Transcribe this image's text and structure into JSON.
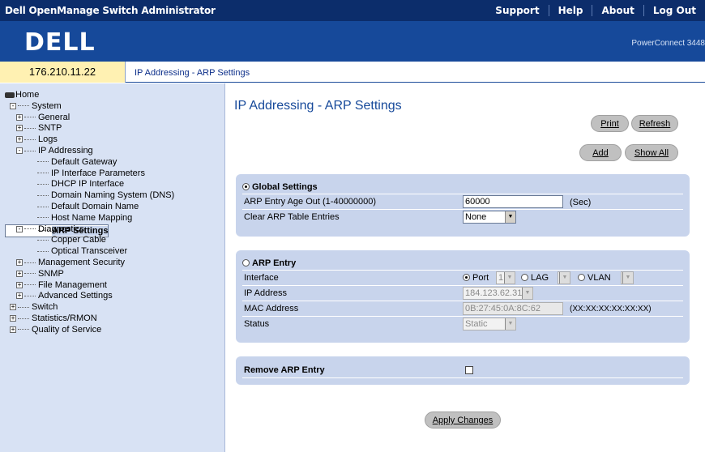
{
  "topbar": {
    "app_title": "Dell OpenManage Switch Administrator",
    "links": [
      "Support",
      "Help",
      "About",
      "Log Out"
    ]
  },
  "banner": {
    "logo": "DELL",
    "model": "PowerConnect 3448"
  },
  "addressbar": {
    "ip": "176.210.11.22",
    "breadcrumb": "IP Addressing - ARP Settings"
  },
  "sidebar": {
    "items": [
      {
        "label": "Home",
        "level": 0,
        "icon": "hdd-icon"
      },
      {
        "label": "System",
        "level": 1,
        "expander": "-"
      },
      {
        "label": "General",
        "level": 2,
        "expander": "+"
      },
      {
        "label": "SNTP",
        "level": 2,
        "expander": "+"
      },
      {
        "label": "Logs",
        "level": 2,
        "expander": "+"
      },
      {
        "label": "IP Addressing",
        "level": 2,
        "expander": "-"
      },
      {
        "label": "Default Gateway",
        "level": 3
      },
      {
        "label": "IP Interface Parameters",
        "level": 3
      },
      {
        "label": "DHCP IP Interface",
        "level": 3
      },
      {
        "label": "Domain Naming System (DNS)",
        "level": 3
      },
      {
        "label": "Default Domain Name",
        "level": 3
      },
      {
        "label": "Host Name Mapping",
        "level": 3
      },
      {
        "label": "ARP Settings",
        "level": 3,
        "selected": true
      },
      {
        "label": "Diagnostics",
        "level": 2,
        "expander": "-"
      },
      {
        "label": "Copper Cable",
        "level": 3
      },
      {
        "label": "Optical Transceiver",
        "level": 3
      },
      {
        "label": "Management Security",
        "level": 2,
        "expander": "+"
      },
      {
        "label": "SNMP",
        "level": 2,
        "expander": "+"
      },
      {
        "label": "File Management",
        "level": 2,
        "expander": "+"
      },
      {
        "label": "Advanced Settings",
        "level": 2,
        "expander": "+"
      },
      {
        "label": "Switch",
        "level": 1,
        "expander": "+"
      },
      {
        "label": "Statistics/RMON",
        "level": 1,
        "expander": "+"
      },
      {
        "label": "Quality of Service",
        "level": 1,
        "expander": "+"
      }
    ]
  },
  "main": {
    "title": "IP Addressing - ARP Settings",
    "buttons": {
      "print": "Print",
      "refresh": "Refresh",
      "add": "Add",
      "show_all": "Show All",
      "apply": "Apply Changes"
    },
    "global": {
      "header": "Global Settings",
      "age_label": "ARP Entry Age Out (1-40000000)",
      "age_value": "60000",
      "age_unit": "(Sec)",
      "clear_label": "Clear ARP Table Entries",
      "clear_value": "None"
    },
    "arp_entry": {
      "header": "ARP Entry",
      "interface_label": "Interface",
      "port_label": "Port",
      "port_value": "1",
      "lag_label": "LAG",
      "vlan_label": "VLAN",
      "ip_label": "IP Address",
      "ip_value": "184.123.62.31",
      "mac_label": "MAC Address",
      "mac_value": "0B:27:45:0A:8C:62",
      "mac_format": "(XX:XX:XX:XX:XX:XX)",
      "status_label": "Status",
      "status_value": "Static"
    },
    "remove": {
      "label": "Remove ARP Entry"
    }
  }
}
